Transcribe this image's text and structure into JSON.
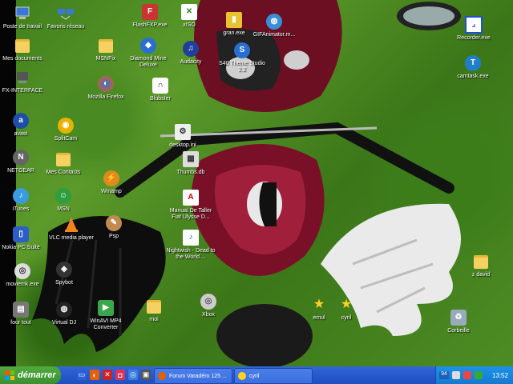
{
  "desktop": {
    "icons": [
      {
        "id": "poste-de-travail",
        "label": "Poste de travail"
      },
      {
        "id": "favoris-reseau",
        "label": "Favoris réseau"
      },
      {
        "id": "flashfxp",
        "label": "FlashFXP.exe"
      },
      {
        "id": "xiso",
        "label": "xISO"
      },
      {
        "id": "gran",
        "label": "gran.exe"
      },
      {
        "id": "gifanimator",
        "label": "GIFAnimator.m..."
      },
      {
        "id": "recorder",
        "label": "Recorder.exe"
      },
      {
        "id": "mes-documents",
        "label": "Mes documents"
      },
      {
        "id": "msnfix",
        "label": "MSNFix"
      },
      {
        "id": "diamond-mine",
        "label": "Diamond Mine Deluxe"
      },
      {
        "id": "audacity",
        "label": "Audacity"
      },
      {
        "id": "s40-theme",
        "label": "S40 Theme Studio 2.2"
      },
      {
        "id": "camtask",
        "label": "camtask.exe"
      },
      {
        "id": "fx-interface",
        "label": "FX-INTERFACE"
      },
      {
        "id": "firefox",
        "label": "Mozilla Firefox"
      },
      {
        "id": "blubster",
        "label": "Blubster"
      },
      {
        "id": "avast",
        "label": "avast"
      },
      {
        "id": "splitcam",
        "label": "SplitCam"
      },
      {
        "id": "desktop-ini",
        "label": "desktop.ini"
      },
      {
        "id": "netgear",
        "label": "NETGEAR"
      },
      {
        "id": "mes-contacts",
        "label": "Mes Contacts"
      },
      {
        "id": "thumbs",
        "label": "Thumbs.db"
      },
      {
        "id": "winamp",
        "label": "Winamp"
      },
      {
        "id": "itunes",
        "label": "iTunes"
      },
      {
        "id": "msn",
        "label": "MSN"
      },
      {
        "id": "manual",
        "label": "Manual De Taller Fiat Ulysse D..."
      },
      {
        "id": "vlc",
        "label": "VLC media player"
      },
      {
        "id": "psp",
        "label": "Psp"
      },
      {
        "id": "nokia",
        "label": "Nokia PC Suite"
      },
      {
        "id": "nightwish",
        "label": "Nightwish - Dead to the World...."
      },
      {
        "id": "spybot",
        "label": "Spybot"
      },
      {
        "id": "moviemk",
        "label": "moviemk.exe"
      },
      {
        "id": "z-david",
        "label": "z david"
      },
      {
        "id": "winavi",
        "label": "WinAVI MP4 Converter"
      },
      {
        "id": "four-tout",
        "label": "four tout"
      },
      {
        "id": "virtual-dj",
        "label": "Virtual DJ"
      },
      {
        "id": "moi",
        "label": "moi"
      },
      {
        "id": "xbox",
        "label": "Xbox"
      },
      {
        "id": "emul",
        "label": "emul"
      },
      {
        "id": "etoile2",
        "label": "cyril"
      },
      {
        "id": "corbeille",
        "label": "Corbeille"
      }
    ]
  },
  "taskbar": {
    "start_label": "démarrer",
    "tasks": [
      {
        "label": "Forum Varadéro 125 ..."
      },
      {
        "label": "cyril"
      }
    ],
    "tray": {
      "badge": "94",
      "time": "13:52"
    }
  },
  "colors": {
    "taskbar": "#2a5bd0",
    "start": "#3b9030",
    "tray": "#1678d0"
  }
}
